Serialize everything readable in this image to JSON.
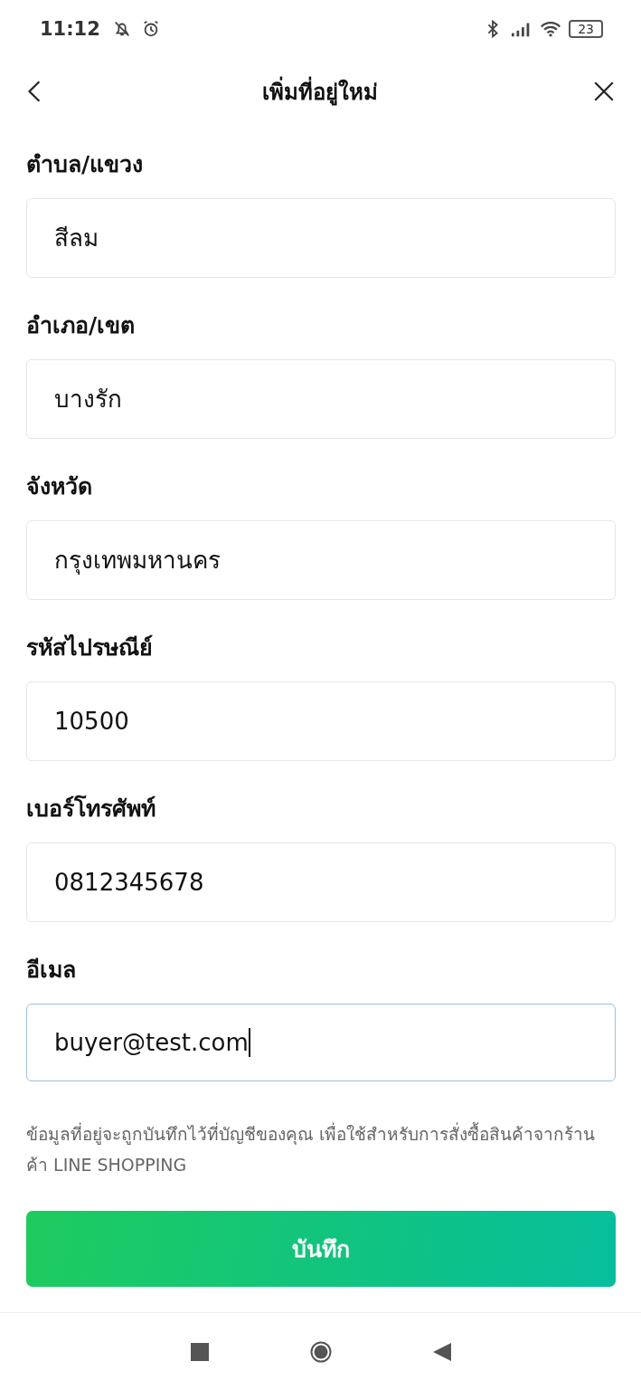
{
  "status_bar": {
    "time": "11:12",
    "battery": "23"
  },
  "header": {
    "title": "เพิ่มที่อยู่ใหม่"
  },
  "fields": [
    {
      "label": "ตำบล/แขวง",
      "value": "สีลม",
      "focused": false
    },
    {
      "label": "อำเภอ/เขต",
      "value": "บางรัก",
      "focused": false
    },
    {
      "label": "จังหวัด",
      "value": "กรุงเทพมหานคร",
      "focused": false
    },
    {
      "label": "รหัสไปรษณีย์",
      "value": "10500",
      "focused": false
    },
    {
      "label": "เบอร์โทรศัพท์",
      "value": "0812345678",
      "focused": false
    },
    {
      "label": "อีเมล",
      "value": "buyer@test.com",
      "focused": true
    }
  ],
  "note": "ข้อมูลที่อยู่จะถูกบันทึกไว้ที่บัญชีของคุณ เพื่อใช้สำหรับการสั่งซื้อสินค้าจากร้านค้า LINE SHOPPING",
  "save_button": "บันทึก"
}
